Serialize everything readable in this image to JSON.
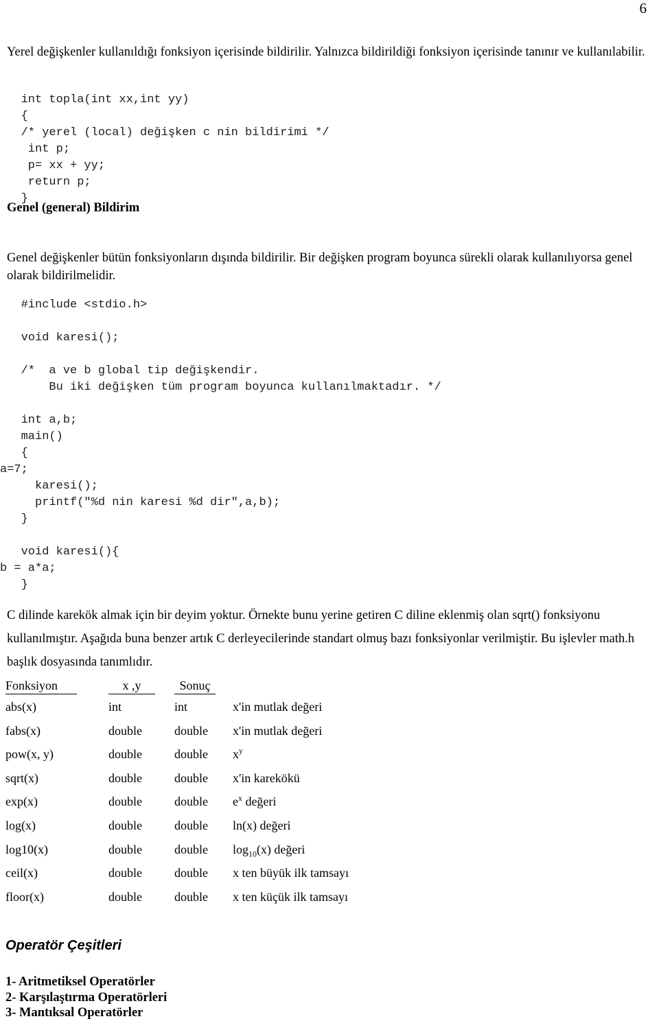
{
  "page": {
    "number": "6"
  },
  "intro_paragraph": "Yerel değişkenler kullanıldığı fonksiyon içerisinde bildirilir. Yalnızca bildirildiği fonksiyon içerisinde tanınır ve kullanılabilir.",
  "code_block_1": "   int topla(int xx,int yy)\n   {\n   /* yerel (local) değişken c nin bildirimi */\n    int p;\n    p= xx + yy;\n    return p;\n   }",
  "heading_genel": "Genel (general) Bildirim",
  "genel_paragraph": "Genel değişkenler bütün fonksiyonların dışında bildirilir. Bir değişken program boyunca sürekli olarak kullanılıyorsa genel olarak bildirilmelidir.",
  "code_block_2": "   #include <stdio.h>\n\n   void karesi();\n\n   /*  a ve b global tip değişkendir.\n       Bu iki değişken tüm program boyunca kullanılmaktadır. */\n\n   int a,b;",
  "code_block_3": "   main()\n   {\na=7;\n     karesi();\n     printf(\"%d nin karesi %d dir\",a,b);\n   }\n\n   void karesi(){\nb = a*a;\n   }",
  "sqrt_paragraph_line1": "C dilinde karekök almak için bir deyim yoktur. Örnekte bunu yerine getiren C diline eklenmiş olan sqrt() fonksiyonu",
  "sqrt_paragraph_line2": "kullanılmıştır.  Aşağıda buna benzer artık C derleyecilerinde  standart olmuş bazı fonksiyonlar verilmiştir. Bu işlevler math.h",
  "sqrt_paragraph_line3": "başlık dosyasında tanımlıdır.",
  "function_table": {
    "headers": [
      "Fonksiyon",
      "x ,y",
      "Sonuç"
    ],
    "rows": [
      {
        "name": "abs(x)",
        "arg": "int",
        "result": "int",
        "desc": "x'in mutlak değeri",
        "desc_kind": "plain"
      },
      {
        "name": "fabs(x)",
        "arg": "double",
        "result": "double",
        "desc": "x'in mutlak değeri",
        "desc_kind": "plain"
      },
      {
        "name": "pow(x, y)",
        "arg": "double",
        "result": "double",
        "desc": "x",
        "desc_kind": "sup",
        "desc_sup": "y",
        "desc_tail": ""
      },
      {
        "name": "sqrt(x)",
        "arg": "double",
        "result": "double",
        "desc": "x'in karekökü",
        "desc_kind": "plain"
      },
      {
        "name": "exp(x)",
        "arg": "double",
        "result": "double",
        "desc": "e",
        "desc_kind": "sup",
        "desc_sup": "x",
        "desc_tail": " değeri"
      },
      {
        "name": "log(x)",
        "arg": "double",
        "result": "double",
        "desc": "ln(x) değeri",
        "desc_kind": "plain"
      },
      {
        "name": "log10(x)",
        "arg": "double",
        "result": "double",
        "desc": "log",
        "desc_kind": "sub",
        "desc_sub": "10",
        "desc_tail": "(x) değeri"
      },
      {
        "name": "ceil(x)",
        "arg": "double",
        "result": "double",
        "desc": "x ten büyük ilk tamsayı",
        "desc_kind": "plain"
      },
      {
        "name": "floor(x)",
        "arg": "double",
        "result": "double",
        "desc": "x ten küçük ilk tamsayı",
        "desc_kind": "plain"
      }
    ]
  },
  "heading_operator": "Operatör Çeşitleri",
  "operator_list": [
    "1- Aritmetiksel Operatörler",
    "2- Karşılaştırma Operatörleri",
    "3- Mantıksal Operatörler"
  ]
}
